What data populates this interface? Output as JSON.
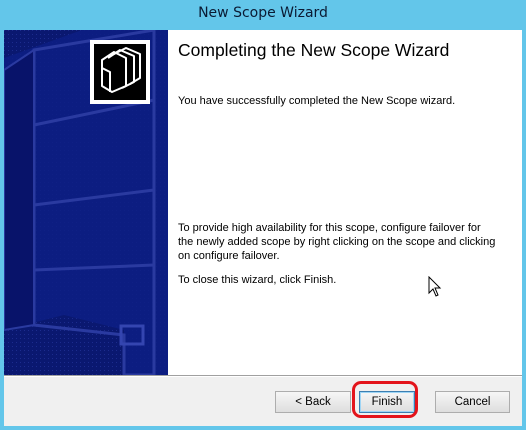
{
  "window": {
    "title": "New Scope Wizard"
  },
  "icons": {
    "wizard_icon": "folders-icon",
    "cursor": "mouse-pointer-icon"
  },
  "content": {
    "heading": "Completing the New Scope Wizard",
    "success_message": "You have successfully completed the New Scope wizard.",
    "failover_message": "To provide high availability for this scope, configure failover for the newly added scope by right clicking on the scope and clicking on configure failover.",
    "close_message": "To close this wizard, click Finish."
  },
  "buttons": {
    "back": "< Back",
    "finish": "Finish",
    "cancel": "Cancel"
  },
  "colors": {
    "titlebar": "#63c6ea",
    "side_panel": "#0a1870",
    "highlight": "#e3141b"
  }
}
